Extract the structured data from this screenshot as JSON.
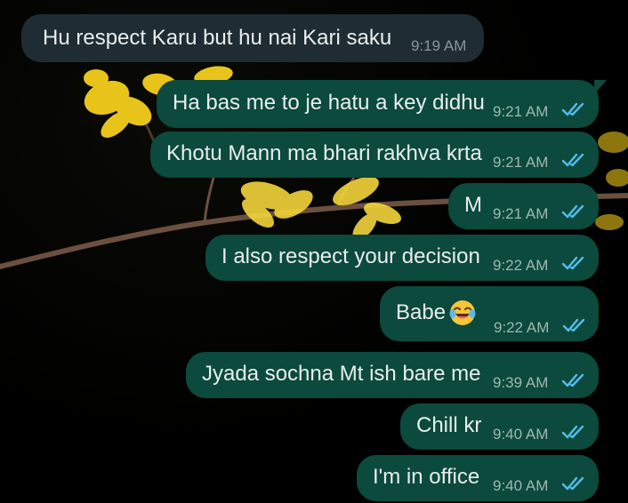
{
  "messages": [
    {
      "direction": "in",
      "text": "Hu respect Karu but hu nai Kari saku",
      "time": "9:19 AM"
    },
    {
      "direction": "out",
      "text": "Ha bas me to je hatu a key didhu",
      "time": "9:21 AM",
      "status": "read"
    },
    {
      "direction": "out",
      "text": "Khotu Mann ma bhari rakhva krta",
      "time": "9:21 AM",
      "status": "read"
    },
    {
      "direction": "out",
      "text": "M",
      "time": "9:21 AM",
      "status": "read"
    },
    {
      "direction": "out",
      "text": "I also respect your decision",
      "time": "9:22 AM",
      "status": "read"
    },
    {
      "direction": "out",
      "text": "Babe",
      "time": "9:22 AM",
      "status": "read",
      "emoji": "face-with-tears-of-joy-icon"
    },
    {
      "direction": "out",
      "text": "Jyada sochna Mt ish bare me",
      "time": "9:39 AM",
      "status": "read"
    },
    {
      "direction": "out",
      "text": "Chill kr",
      "time": "9:40 AM",
      "status": "read"
    },
    {
      "direction": "out",
      "text": "I'm in office",
      "time": "9:40 AM",
      "status": "read"
    }
  ],
  "colors": {
    "incoming_bubble": "#1f2c34",
    "outgoing_bubble": "#0b4a3c",
    "read_tick": "#53bdeb",
    "text": "#e9edef"
  }
}
